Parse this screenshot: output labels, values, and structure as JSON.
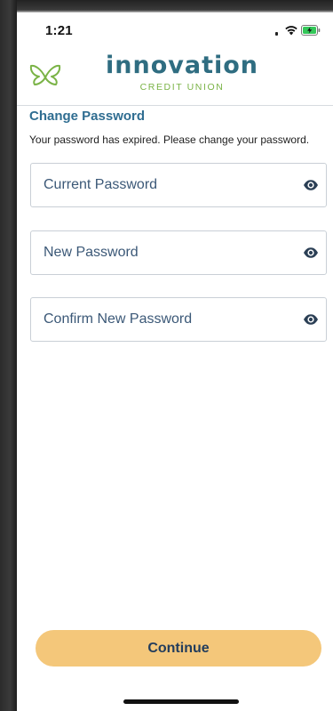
{
  "status_bar": {
    "time": "1:21"
  },
  "brand": {
    "name": "innovation",
    "subtitle": "CREDIT UNION",
    "primary_color": "#2f6d81",
    "accent_color": "#7ab346"
  },
  "page": {
    "title": "Change Password",
    "description": "Your password has expired. Please change your password."
  },
  "fields": [
    {
      "label": "Current Password",
      "icon": "eye-icon"
    },
    {
      "label": "New Password",
      "icon": "eye-icon"
    },
    {
      "label": "Confirm New Password",
      "icon": "eye-icon"
    }
  ],
  "actions": {
    "continue_label": "Continue",
    "button_color": "#f4c77a"
  }
}
